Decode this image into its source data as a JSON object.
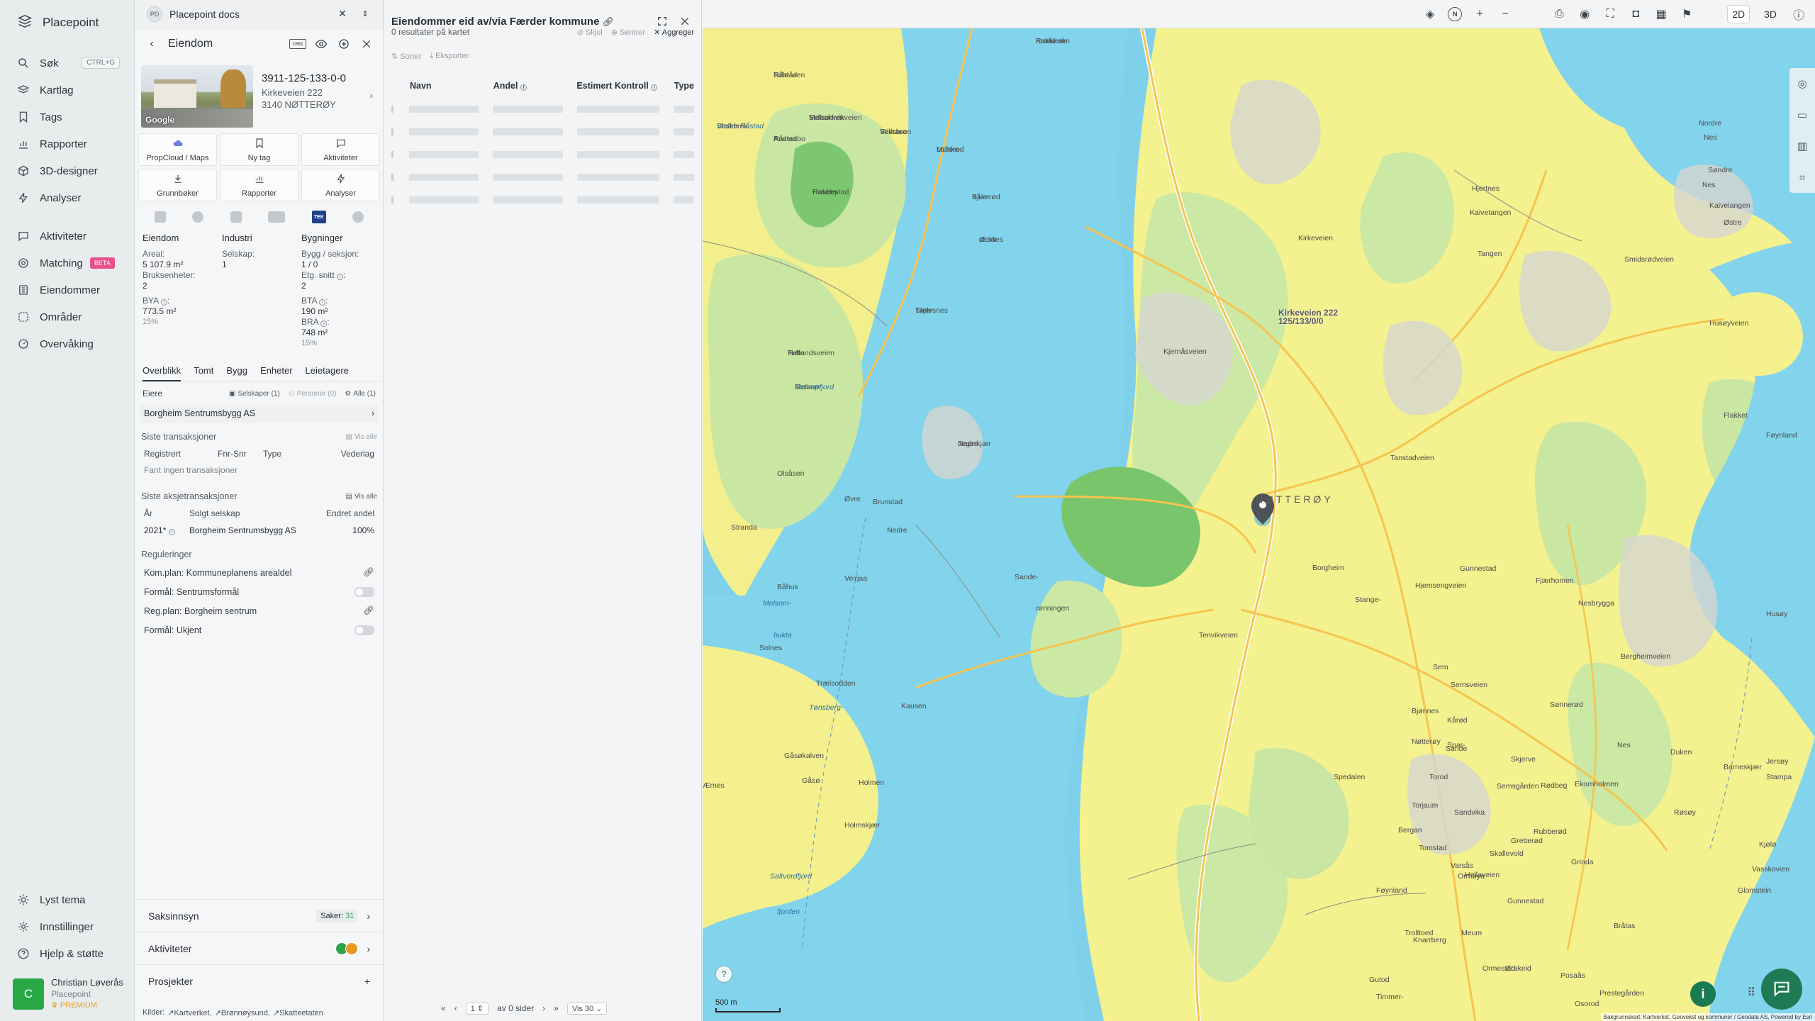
{
  "nav": {
    "brand": "Placepoint",
    "items": [
      {
        "label": "Søk",
        "icon": "search-icon",
        "shortcut": "CTRL+G"
      },
      {
        "label": "Kartlag",
        "icon": "layers-icon"
      },
      {
        "label": "Tags",
        "icon": "bookmark-icon"
      },
      {
        "label": "Rapporter",
        "icon": "bar-chart-icon"
      },
      {
        "label": "3D-designer",
        "icon": "cube-icon"
      },
      {
        "label": "Analyser",
        "icon": "bolt-icon"
      }
    ],
    "items2": [
      {
        "label": "Aktiviteter",
        "icon": "message-icon"
      },
      {
        "label": "Matching",
        "icon": "target-icon",
        "badge": "BETA"
      },
      {
        "label": "Eiendommer",
        "icon": "building-icon"
      },
      {
        "label": "Områder",
        "icon": "area-icon"
      },
      {
        "label": "Overvåking",
        "icon": "monitor-icon"
      }
    ],
    "bottom": [
      {
        "label": "Lyst tema",
        "icon": "sun-icon"
      },
      {
        "label": "Innstillinger",
        "icon": "gear-icon"
      },
      {
        "label": "Hjelp & støtte",
        "icon": "help-icon"
      }
    ],
    "user": {
      "initial": "C",
      "name": "Christian Løverås",
      "org": "Placepoint",
      "plan": "PREMIUM"
    }
  },
  "property_panel": {
    "doc_tab": {
      "badge": "PD",
      "title": "Placepoint docs"
    },
    "header_title": "Eiendom",
    "header_badge": "1881",
    "matrikkel": "3911-125-133-0-0",
    "street": "Kirkeveien 222",
    "postal": "3140 NØTTERØY",
    "photo_credit": "Google",
    "actions": [
      {
        "label": "PropCloud / Maps"
      },
      {
        "label": "Ny tag"
      },
      {
        "label": "Aktiviteter"
      },
      {
        "label": "Grunnbøker"
      },
      {
        "label": "Rapporter"
      },
      {
        "label": "Analyser"
      }
    ],
    "tek_label": "TEK",
    "facts": {
      "col1_head": "Eiendom",
      "areal_label": "Areal:",
      "areal_value": "5 107.9 m²",
      "bruk_label": "Bruksenheter:",
      "bruk_value": "2",
      "bya_label": "BYA",
      "bya_value": "773.5 m²",
      "bya_pct": "15%",
      "col2_head": "Industri",
      "selskap_label": "Selskap:",
      "selskap_value": "1",
      "col3_head": "Bygninger",
      "bygg_label": "Bygg / seksjon:",
      "bygg_value": "1 / 0",
      "etg_label": "Etg. snitt",
      "etg_value": "2",
      "bta_label": "BTA",
      "bta_value": "190 m²",
      "bra_label": "BRA",
      "bra_value": "748 m²",
      "bra_pct": "15%"
    },
    "tabs": [
      "Overblikk",
      "Tomt",
      "Bygg",
      "Enheter",
      "Leietagere"
    ],
    "owners": {
      "label": "Eiere",
      "filter_companies": "Selskaper (1)",
      "filter_persons": "Personer (0)",
      "filter_all": "Alle (1)",
      "owner_name": "Borgheim Sentrumsbygg AS"
    },
    "transactions": {
      "title": "Siste transaksjoner",
      "show_all": "Vis alle",
      "cols": [
        "Registrert",
        "Fnr-Snr",
        "Type",
        "Vederlag"
      ],
      "empty": "Fant ingen transaksjoner"
    },
    "share_tx": {
      "title": "Siste aksjetransaksjoner",
      "show_all": "Vis alle",
      "cols": [
        "År",
        "Solgt selskap",
        "Endret andel"
      ],
      "row": {
        "year": "2021*",
        "company": "Borgheim Sentrumsbygg AS",
        "share": "100%"
      }
    },
    "regulations": {
      "title": "Reguleringer",
      "items": [
        {
          "label": "Kom.plan: Kommuneplanens arealdel",
          "kind": "link"
        },
        {
          "label": "Formål: Sentrumsformål",
          "kind": "toggle"
        },
        {
          "label": "Reg.plan: Borgheim sentrum",
          "kind": "link"
        },
        {
          "label": "Formål: Ukjent",
          "kind": "toggle"
        }
      ]
    },
    "accordions": {
      "saksinnsyn": "Saksinnsyn",
      "saker_label": "Saker:",
      "saker_count": "31",
      "aktiviteter": "Aktiviteter",
      "prosjekter": "Prosjekter"
    },
    "sources": {
      "label": "Kilder:",
      "items": [
        "Kartverket,",
        "Brønnøysund,",
        "Skatteetaten"
      ]
    }
  },
  "results_panel": {
    "title": "Eiendommer eid av/via Færder kommune",
    "count_text": "0 resultater på kartet",
    "tools": [
      "Skjul",
      "Sentrer",
      "Aggreger"
    ],
    "row_tools": [
      "Sorter",
      "Eksporter"
    ],
    "columns": [
      "Navn",
      "Andel",
      "Estimert Kontroll",
      "Type"
    ],
    "pager": {
      "page": "1",
      "of_text": "av 0 sider",
      "per_page": "Vis 30"
    }
  },
  "map": {
    "toolbar_2d": "2D",
    "toolbar_3d": "3D",
    "compass": "N",
    "scale": "500 m",
    "marker_address": "Kirkeveien 222",
    "marker_id": "125/133/0/0",
    "region_label": "NØTTERØY",
    "attribution": "Bakgrunnskart: Kartverket, Geovekst og kommuner / Geodata AS, Powered by Esri",
    "labels": [
      "Rakkevik",
      "Råstad",
      "Melsomvikveien",
      "Vestre Råstad",
      "Råstad",
      "Vedrasen",
      "Røbbestad",
      "Munke-",
      "Sjue-",
      "stokk",
      "Tufte",
      "Skjersnes",
      "Melsom",
      "Nedre",
      "Olsåsen",
      "Brunstad",
      "Øvre",
      "Nedre",
      "Stranda",
      "Båhus",
      "Veirjaa",
      "Sande-",
      "rønningen",
      "Melsom-",
      "bukta",
      "Solnes",
      "Trælsodden",
      "Kausen",
      "Tønsberg-",
      "Gåsøkalven",
      "Gåsø",
      "Holmen",
      "Holmskjær",
      "Ærnes",
      "Saltverdfjord",
      "fjorden",
      "Hjertnes",
      "Kaivetangen",
      "Tangen",
      "Nordre",
      "Nes",
      "Søndre",
      "Nes",
      "Kaiveiangen",
      "Østre",
      "Kirkeveien",
      "Kjernåsveien",
      "Tanstadveien",
      "Hellaveien",
      "Hjemsengveien",
      "Semsveien",
      "Tenvikveien",
      "Bergheimveien",
      "Smidsrødveien",
      "Husøyveien",
      "Flakket",
      "Føynland",
      "Husøy",
      "Jersøy",
      "Sande",
      "Gunnestad",
      "Stange-",
      "Sem",
      "Bjønnes",
      "Borgheim",
      "Nes",
      "Duken",
      "Barneskjær",
      "Stampa",
      "Fjærhomen",
      "Nesbrygga",
      "Sønnerød",
      "Semsgården",
      "Ormøya",
      "Meum",
      "Rubberød",
      "Rødbeg",
      "Skallevold",
      "Knarrberg",
      "Bergan",
      "Føynland",
      "Varsås",
      "Tomstad",
      "Trolltoed",
      "Skjerve",
      "Gunnestad",
      "Ørakeid",
      "Ormestad",
      "Kjølø",
      "Bråtas",
      "Glomstein",
      "Gutod",
      "Timmer-",
      "Posaås",
      "Prestegården",
      "Grinda",
      "Gretterød",
      "Torjaum",
      "Kårød",
      "Osorod",
      "Ekornholmen",
      "Spar-",
      "Sandvika",
      "Torod",
      "Røsøy",
      "Spedalen",
      "Nøtterøy",
      "Vasskovien",
      "Krækkoen",
      "Tolleåsen",
      "Solbakken",
      "Stalkbrek",
      "Andersbo",
      "Stiksbro",
      "Huseby",
      "Lofterod",
      "Kåkerød",
      "Ørsnes",
      "Hellandsveien",
      "Tørk-",
      "Tastrupfjord",
      "Jegerkjær"
    ]
  }
}
